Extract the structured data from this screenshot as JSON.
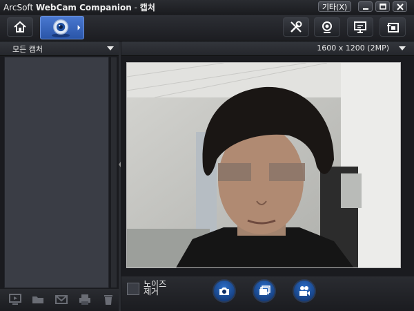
{
  "window": {
    "brand": "ArcSoft",
    "product": "WebCam Companion",
    "separator": "-",
    "section": "캡처",
    "extras_label": "기타(X)"
  },
  "toolbar": {
    "home": "home-icon",
    "capture": "webcam-capture-icon",
    "tools": "tools-icon",
    "monitor": "surveillance-icon",
    "present": "presentation-icon",
    "share": "video-share-icon"
  },
  "left_panel": {
    "filter_label": "모든 캡처"
  },
  "right_panel": {
    "resolution": "1600 x 1200 (2MP)"
  },
  "bottom": {
    "noise_label": "노이즈 제거",
    "noise_checked": false,
    "left_icons": [
      "slideshow-icon",
      "open-folder-icon",
      "email-icon",
      "print-icon",
      "trash-icon"
    ],
    "capture_buttons": [
      "camera-icon",
      "burst-capture-icon",
      "video-record-icon"
    ]
  },
  "colors": {
    "accent": "#2a55a8",
    "bg": "#1a1b1f",
    "panel": "#3a3d45"
  }
}
